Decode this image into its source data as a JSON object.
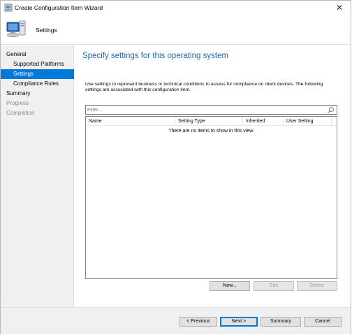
{
  "window": {
    "title": "Create Configuration Item Wizard"
  },
  "header": {
    "title": "Settings"
  },
  "nav": {
    "items": [
      {
        "label": "General",
        "state": "normal"
      },
      {
        "label": "Supported Platforms",
        "state": "normal"
      },
      {
        "label": "Settings",
        "state": "selected"
      },
      {
        "label": "Compliance Rules",
        "state": "normal"
      },
      {
        "label": "Summary",
        "state": "normal"
      },
      {
        "label": "Progress",
        "state": "disabled"
      },
      {
        "label": "Completion",
        "state": "disabled"
      }
    ]
  },
  "main": {
    "heading": "Specify settings for this operating system",
    "description": "Use settings to represent business or technical conditions to assess for compliance on client devices. The following settings are associated with this configuration item.",
    "filter": {
      "placeholder": "Filter...",
      "value": ""
    },
    "grid": {
      "columns": [
        "Name",
        "Setting Type",
        "Inherited",
        "User Setting"
      ],
      "empty_text": "There are no items to show in this view."
    },
    "actions": {
      "new": "New...",
      "edit": "Edit",
      "delete": "Delete"
    }
  },
  "footer": {
    "previous": "< Previous",
    "next": "Next >",
    "summary": "Summary",
    "cancel": "Cancel"
  },
  "colors": {
    "accent": "#0078d7",
    "heading": "#1e6ab4",
    "nav_bg": "#f0f0f0"
  }
}
